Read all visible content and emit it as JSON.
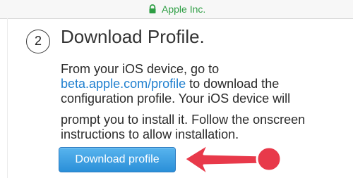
{
  "browser": {
    "url_display": "Apple Inc.",
    "secure_icon": "lock-icon"
  },
  "step": {
    "number": "2",
    "title": "Download Profile."
  },
  "instructions": {
    "line1": "From your iOS device, go to",
    "link": "beta.apple.com/profile",
    "line2_rest": " to download the",
    "line3": "configuration profile. Your iOS device will",
    "line4": "prompt you to install it. Follow the onscreen",
    "line5": "instructions to allow installation."
  },
  "actions": {
    "download_label": "Download profile"
  },
  "annotation": {
    "icon": "red-arrow-pointing-left-icon",
    "color": "#e8394a"
  },
  "colors": {
    "link": "#1f7fcf",
    "button_top": "#58b4ee",
    "button_bottom": "#2a8fd8",
    "url_green": "#2e9e44"
  }
}
